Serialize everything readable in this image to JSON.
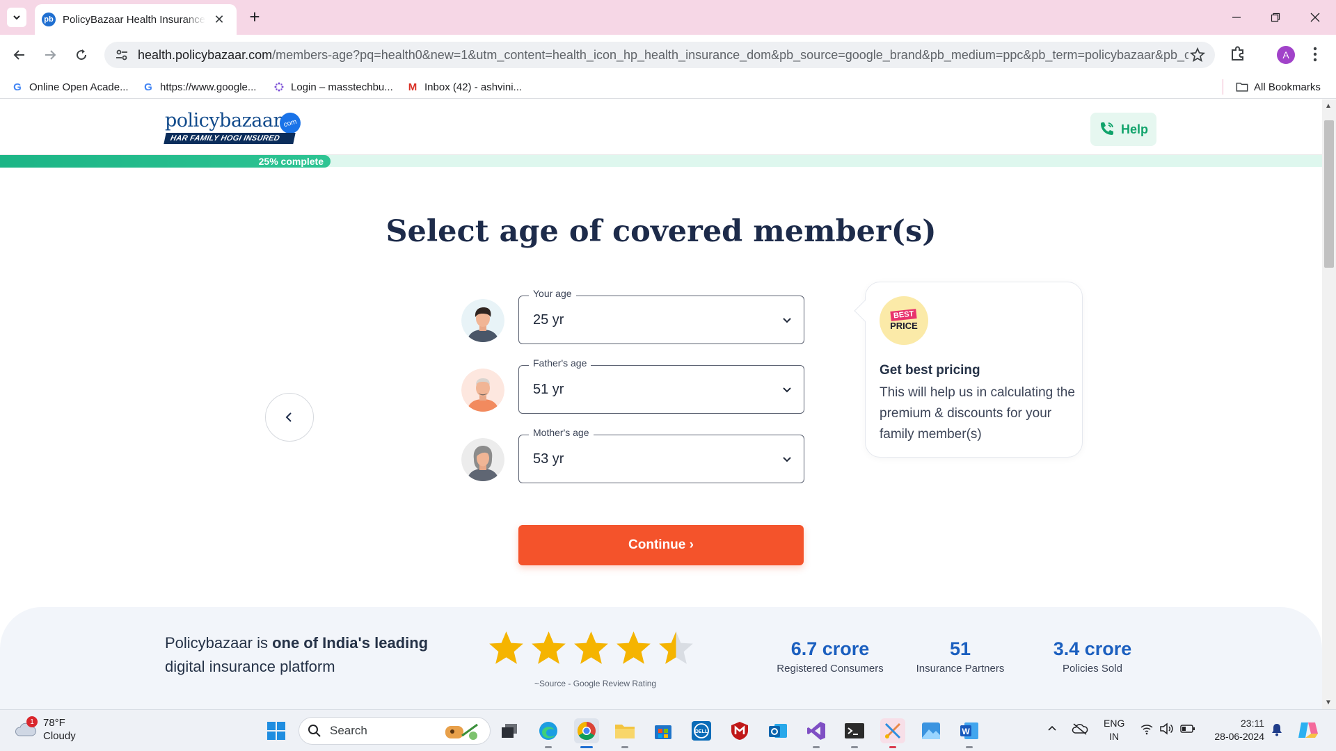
{
  "browser": {
    "tab_title": "PolicyBazaar Health Insurance: Compare",
    "favicon_text": "pb",
    "url_domain": "health.policybazaar.com",
    "url_rest": "/members-age?pq=health0&new=1&utm_content=health_icon_hp_health_insurance_dom&pb_source=google_brand&pb_medium=ppc&pb_term=policybazaar&pb_ca...",
    "avatar_letter": "A",
    "bookmarks": [
      {
        "label": "Online Open Acade...",
        "icon": "google-icon"
      },
      {
        "label": "https://www.google...",
        "icon": "google-icon"
      },
      {
        "label": "Login – masstechbu...",
        "icon": "slack-dots-icon"
      },
      {
        "label": "Inbox (42) - ashvini...",
        "icon": "gmail-icon"
      }
    ],
    "all_bookmarks_label": "All Bookmarks"
  },
  "header": {
    "logo_word": "policybazaar",
    "logo_com": "com",
    "logo_tagline": "HAR FAMILY HOGI INSURED",
    "help_label": "Help"
  },
  "progress": {
    "fraction": 0.25,
    "label": "25% complete"
  },
  "main": {
    "heading": "Select age of covered member(s)",
    "members": [
      {
        "label": "Your age",
        "value": "25 yr",
        "avatar": "young-man-avatar"
      },
      {
        "label": "Father's age",
        "value": "51 yr",
        "avatar": "older-man-avatar"
      },
      {
        "label": "Mother's age",
        "value": "53 yr",
        "avatar": "older-woman-avatar"
      }
    ],
    "continue_label": "Continue ›"
  },
  "price_card": {
    "badge_top": "BEST",
    "badge_bottom": "PRICE",
    "title": "Get best pricing",
    "body": "This will help us in calculating the premium & discounts for your family member(s)"
  },
  "trust": {
    "text_plain_1": "Policybazaar is ",
    "text_bold": "one of India's leading",
    "text_plain_2": "digital insurance platform",
    "rating_stars": 4.5,
    "rating_source": "~Source - Google Review Rating",
    "stats": [
      {
        "value": "6.7 crore",
        "label": "Registered Consumers"
      },
      {
        "value": "51",
        "label": "Insurance Partners"
      },
      {
        "value": "3.4 crore",
        "label": "Policies Sold"
      }
    ]
  },
  "taskbar": {
    "weather_temp": "78°F",
    "weather_desc": "Cloudy",
    "weather_badge": "1",
    "search_label": "Search",
    "lang_1": "ENG",
    "lang_2": "IN",
    "time": "23:11",
    "date": "28-06-2024"
  },
  "colors": {
    "brand_blue": "#124b8c",
    "accent_orange": "#f4532b",
    "progress_green": "#1cb586",
    "help_green": "#11a36b",
    "star_gold": "#f5b400"
  }
}
